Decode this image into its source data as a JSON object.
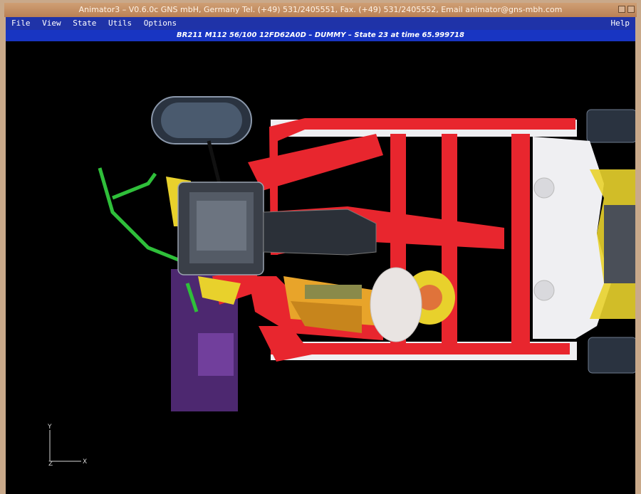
{
  "window": {
    "title": "Animator3 – V0.6.0c GNS mbH, Germany Tel. (+49) 531/2405551, Fax. (+49) 531/2405552, Email animator@gns-mbh.com"
  },
  "menu": {
    "items": [
      "File",
      "View",
      "State",
      "Utils",
      "Options"
    ],
    "help": "Help"
  },
  "status": {
    "text": "BR211 M112 56/100 12FD62A0D – DUMMY – State 23 at time 65.999718"
  },
  "viewport": {
    "axes": {
      "y": "Y",
      "z": "Z",
      "x": "X"
    }
  },
  "colors": {
    "frame": "#e8262e",
    "engine": "#3a3f48",
    "yellow_parts": "#e8d12c",
    "green_parts": "#2fbf3a",
    "airbag": "#e9e4e2",
    "dummy": "#e8a42a",
    "floor": "#efeff2",
    "tire": "#2a3340",
    "purple_parts": "#5a2f84"
  }
}
